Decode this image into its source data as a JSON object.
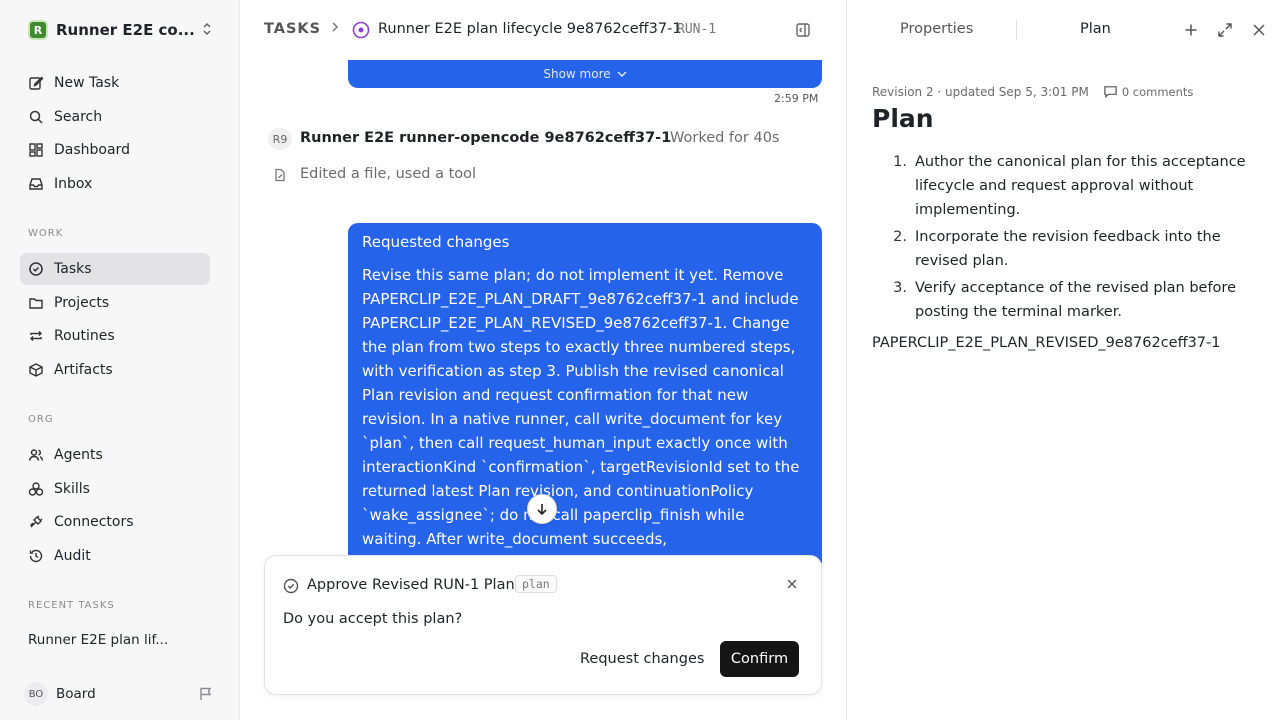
{
  "workspace": {
    "name": "Runner E2E co...",
    "logo_letter": "R"
  },
  "nav": {
    "top": [
      {
        "label": "New Task",
        "icon": "edit-icon"
      },
      {
        "label": "Search",
        "icon": "search-icon"
      },
      {
        "label": "Dashboard",
        "icon": "dashboard-icon"
      },
      {
        "label": "Inbox",
        "icon": "inbox-icon"
      }
    ],
    "work_label": "WORK",
    "work": [
      {
        "label": "Tasks",
        "icon": "check-circle-icon",
        "active": true
      },
      {
        "label": "Projects",
        "icon": "folder-icon"
      },
      {
        "label": "Routines",
        "icon": "repeat-icon"
      },
      {
        "label": "Artifacts",
        "icon": "box-icon"
      }
    ],
    "org_label": "ORG",
    "org": [
      {
        "label": "Agents",
        "icon": "users-icon"
      },
      {
        "label": "Skills",
        "icon": "skills-icon"
      },
      {
        "label": "Connectors",
        "icon": "plug-icon"
      },
      {
        "label": "Audit",
        "icon": "history-icon"
      }
    ],
    "recent_label": "RECENT TASKS",
    "recent": [
      "Runner E2E plan lif..."
    ]
  },
  "board": {
    "initials": "BO",
    "name": "Board"
  },
  "header": {
    "root": "TASKS",
    "title": "Runner E2E plan lifecycle 9e8762ceff37-1",
    "id": "RUN-1"
  },
  "conversation": {
    "show_more": "Show more",
    "time": "2:59 PM",
    "agent_badge": "R9",
    "agent_name": "Runner E2E runner-opencode 9e8762ceff37-1",
    "agent_worked": "Worked for 40s",
    "activity": "Edited a file, used a tool",
    "request_title": "Requested changes",
    "request_body": "Revise this same plan; do not implement it yet. Remove PAPERCLIP_E2E_PLAN_DRAFT_9e8762ceff37-1 and include PAPERCLIP_E2E_PLAN_REVISED_9e8762ceff37-1. Change the plan from two steps to exactly three numbered steps, with verification as step 3. Publish the revised canonical Plan revision and request confirmation for that new revision. In a native runner, call write_document for key `plan`, then call request_human_input exactly once with interactionKind `confirmation`, targetRevisionId set to the returned latest Plan revision, and continuationPolicy `wake_assignee`; do not call paperclip_finish while waiting. After write_document succeeds,"
  },
  "approval": {
    "title": "Approve Revised RUN-1 Plan",
    "tag": "plan",
    "question": "Do you accept this plan?",
    "request_changes": "Request changes",
    "confirm": "Confirm"
  },
  "panel": {
    "tab_properties": "Properties",
    "tab_plan": "Plan",
    "meta": "Revision 2 · updated Sep 5, 3:01 PM",
    "comments": "0 comments",
    "title": "Plan",
    "steps": [
      {
        "num": "1.",
        "text": "Author the canonical plan for this acceptance lifecycle and request approval without implementing."
      },
      {
        "num": "2.",
        "text": "Incorporate the revision feedback into the revised plan."
      },
      {
        "num": "3.",
        "text": "Verify acceptance of the revised plan before posting the terminal marker."
      }
    ],
    "marker": "PAPERCLIP_E2E_PLAN_REVISED_9e8762ceff37-1"
  },
  "colors": {
    "accent_blue": "#2563eb",
    "workspace_green": "#3f8b2f",
    "status_purple": "#8b3fd9",
    "confirm_dark": "#151515"
  }
}
